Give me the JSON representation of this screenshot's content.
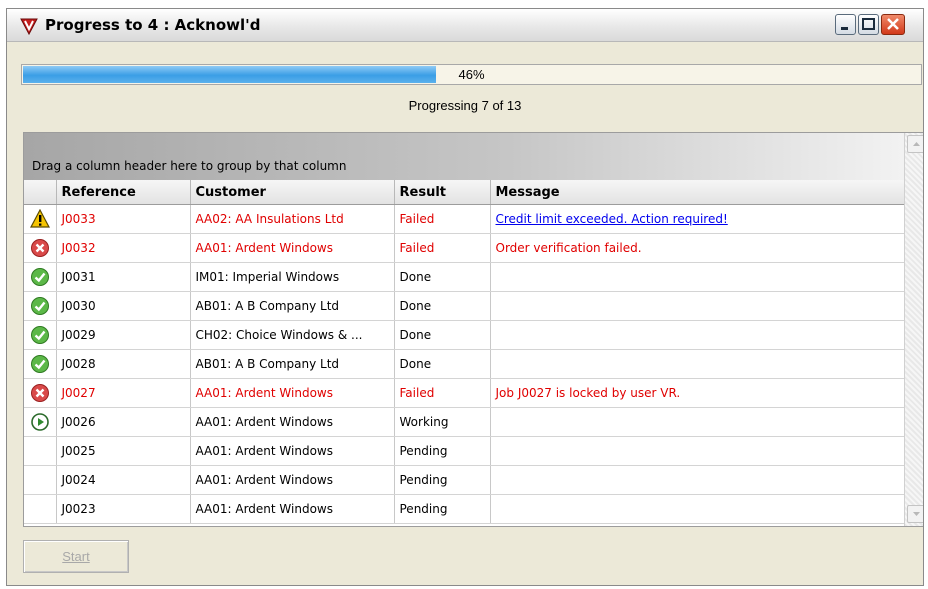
{
  "window": {
    "title": "Progress to 4 : Acknowl'd"
  },
  "progress": {
    "value": 0.46,
    "label": "46%"
  },
  "status_text": "Progressing 7 of 13",
  "grid": {
    "group_hint": "Drag a column header here to group by that column",
    "columns": [
      "Reference",
      "Customer",
      "Result",
      "Message"
    ],
    "rows": [
      {
        "icon": "warning-icon",
        "state": "warning",
        "reference": "J0033",
        "customer": "AA02: AA Insulations Ltd",
        "result": "Failed",
        "message": "Credit limit exceeded. Action required!"
      },
      {
        "icon": "error-icon",
        "state": "failed",
        "reference": "J0032",
        "customer": "AA01: Ardent Windows",
        "result": "Failed",
        "message": "Order verification failed."
      },
      {
        "icon": "check-icon",
        "state": "done",
        "reference": "J0031",
        "customer": "IM01: Imperial Windows",
        "result": "Done",
        "message": ""
      },
      {
        "icon": "check-icon",
        "state": "done",
        "reference": "J0030",
        "customer": "AB01: A B Company Ltd",
        "result": "Done",
        "message": ""
      },
      {
        "icon": "check-icon",
        "state": "done",
        "reference": "J0029",
        "customer": "CH02: Choice Windows & ...",
        "result": "Done",
        "message": ""
      },
      {
        "icon": "check-icon",
        "state": "done",
        "reference": "J0028",
        "customer": "AB01: A B Company Ltd",
        "result": "Done",
        "message": ""
      },
      {
        "icon": "error-icon",
        "state": "failed",
        "reference": "J0027",
        "customer": "AA01: Ardent Windows",
        "result": "Failed",
        "message": "Job J0027 is locked by user VR."
      },
      {
        "icon": "play-icon",
        "state": "working",
        "reference": "J0026",
        "customer": "AA01: Ardent Windows",
        "result": "Working",
        "message": ""
      },
      {
        "icon": "",
        "state": "pending",
        "reference": "J0025",
        "customer": "AA01: Ardent Windows",
        "result": "Pending",
        "message": ""
      },
      {
        "icon": "",
        "state": "pending",
        "reference": "J0024",
        "customer": "AA01: Ardent Windows",
        "result": "Pending",
        "message": ""
      },
      {
        "icon": "",
        "state": "pending",
        "reference": "J0023",
        "customer": "AA01: Ardent Windows",
        "result": "Pending",
        "message": ""
      }
    ]
  },
  "buttons": {
    "start": "Start"
  },
  "colors": {
    "failed_text": "#e00000",
    "link": "#0000ee",
    "progress_fill": "#3a9ee6"
  }
}
